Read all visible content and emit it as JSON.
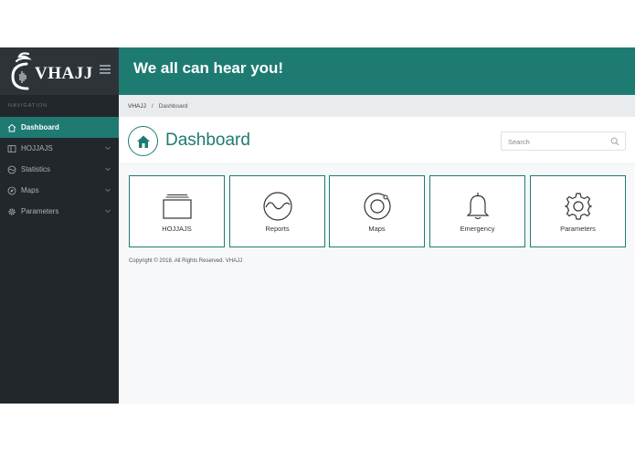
{
  "brand": {
    "name": "VHAJJ"
  },
  "header": {
    "slogan": "We all can hear you!"
  },
  "sidebar": {
    "nav_title": "NAVIGATION",
    "items": [
      {
        "label": "Dashboard",
        "icon": "home-icon",
        "active": true
      },
      {
        "label": "HOJJAJS",
        "icon": "layout-icon",
        "active": false
      },
      {
        "label": "Statistics",
        "icon": "pulse-icon",
        "active": false
      },
      {
        "label": "Maps",
        "icon": "compass-icon",
        "active": false
      },
      {
        "label": "Parameters",
        "icon": "gear-icon",
        "active": false
      }
    ]
  },
  "breadcrumb": {
    "root": "VHAJJ",
    "separator": "/",
    "current": "Dashboard"
  },
  "page": {
    "title": "Dashboard",
    "search_placeholder": "Search"
  },
  "tiles": [
    {
      "label": "HOJJAJS",
      "icon": "folder-icon"
    },
    {
      "label": "Reports",
      "icon": "wave-icon"
    },
    {
      "label": "Maps",
      "icon": "target-icon"
    },
    {
      "label": "Emergency",
      "icon": "bell-icon"
    },
    {
      "label": "Parameters",
      "icon": "gear-icon"
    }
  ],
  "footer": {
    "copyright": "Copyright © 2018. All Rights Reserved. VHAJJ"
  },
  "colors": {
    "primary": "#1e7b72",
    "sidebar": "#22272b",
    "brand_bg": "#2e3338"
  }
}
